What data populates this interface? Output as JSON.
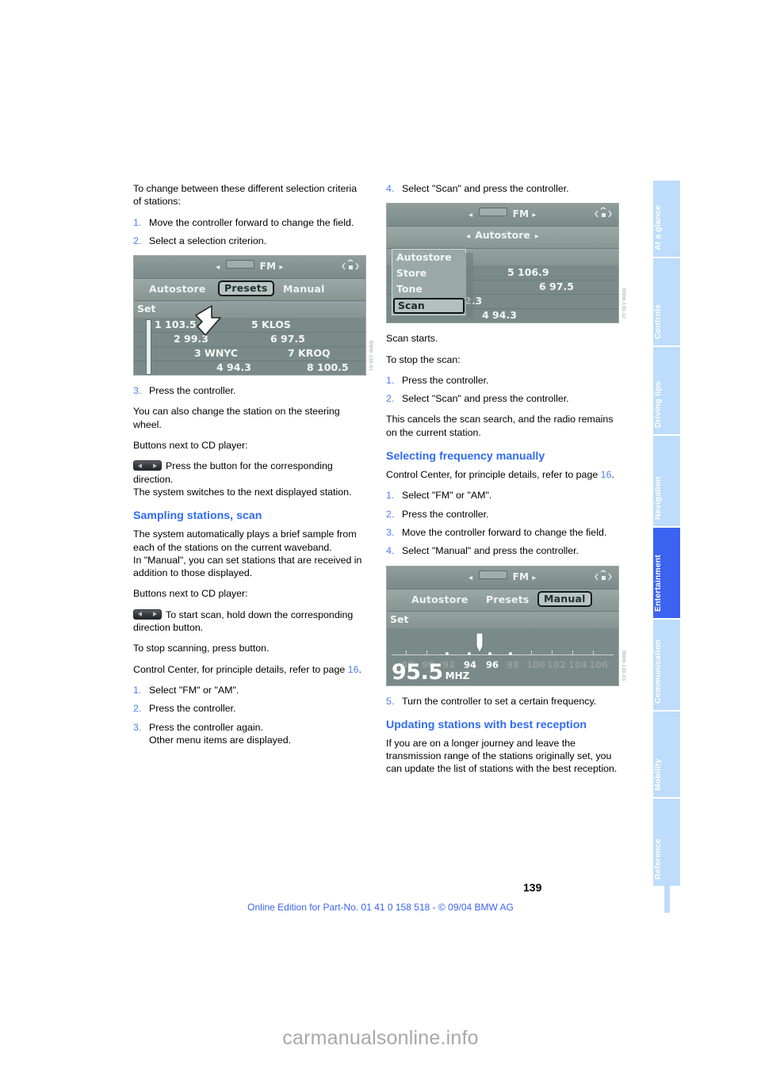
{
  "document": {
    "page_number": "139",
    "edition_line": "Online Edition for Part-No. 01 41 0 158 518 - © 09/04 BMW AG",
    "watermark": "carmanualsonline.info"
  },
  "sidebar": {
    "tabs": [
      {
        "label": "At a glance",
        "active": false
      },
      {
        "label": "Controls",
        "active": false
      },
      {
        "label": "Driving tips",
        "active": false
      },
      {
        "label": "Navigation",
        "active": false
      },
      {
        "label": "Entertainment",
        "active": true
      },
      {
        "label": "Communication",
        "active": false
      },
      {
        "label": "Mobility",
        "active": false
      },
      {
        "label": "Reference",
        "active": false
      }
    ]
  },
  "left_column": {
    "intro": "To change between these different selection criteria of stations:",
    "steps_1": [
      {
        "num": "1.",
        "text": "Move the controller forward to change the field."
      },
      {
        "num": "2.",
        "text": "Select a selection criterion."
      }
    ],
    "figure_presets": {
      "band": "FM",
      "tabs": [
        {
          "label": "Autostore",
          "selected": false
        },
        {
          "label": "Presets",
          "selected": true
        },
        {
          "label": "Manual",
          "selected": false
        }
      ],
      "set_label": "Set",
      "presets": [
        {
          "left": "1 103.5",
          "right": "5 KLOS"
        },
        {
          "left": "2 99.3",
          "right": "6 97.5"
        },
        {
          "left": "3 WNYC",
          "right": "7 KROQ"
        },
        {
          "left": "4 94.3",
          "right": "8 100.5"
        }
      ]
    },
    "step_3": {
      "num": "3.",
      "text": "Press the controller."
    },
    "para_steering": "You can also change the station on the steering wheel.",
    "para_cd_buttons": "Buttons next to CD player:",
    "para_direction": "Press the button for the corresponding direction.",
    "para_switches": "The system switches to the next displayed station.",
    "heading_sampling": "Sampling stations, scan",
    "para_sample": "The system automatically plays a brief sample from each of the stations on the current waveband.",
    "para_manual_set": "In \"Manual\", you can set stations that are received in addition to those displayed.",
    "para_cd_buttons_2": "Buttons next to CD player:",
    "para_start_scan": "To start scan, hold down the corresponding direction button.",
    "para_stop_scan": "To stop scanning, press button.",
    "para_control_center_pre": "Control Center, for principle details, refer to page ",
    "para_control_center_ref": "16",
    "para_control_center_post": ".",
    "steps_2": [
      {
        "num": "1.",
        "text": "Select \"FM\" or \"AM\"."
      },
      {
        "num": "2.",
        "text": "Press the controller."
      },
      {
        "num": "3.",
        "text": "Press the controller again.\nOther menu items are displayed."
      }
    ]
  },
  "right_column": {
    "step_4": {
      "num": "4.",
      "text": "Select \"Scan\" and press the controller."
    },
    "figure_scan": {
      "band": "FM",
      "center_label": "Autostore",
      "menu": [
        {
          "label": "Autostore",
          "selected": false
        },
        {
          "label": "Store",
          "selected": false
        },
        {
          "label": "Tone",
          "selected": false
        },
        {
          "label": "Scan",
          "selected": true
        }
      ],
      "presets": [
        {
          "left": "",
          "right": "5 106.9"
        },
        {
          "left": "",
          "right": "6 97.5"
        },
        {
          "left": "2.3",
          "right": ""
        },
        {
          "left": "4 94.3",
          "right": ""
        }
      ]
    },
    "para_scan_starts": "Scan starts.",
    "para_stop_scan": "To stop the scan:",
    "steps_stop": [
      {
        "num": "1.",
        "text": "Press the controller."
      },
      {
        "num": "2.",
        "text": "Select \"Scan\" and press the controller."
      }
    ],
    "para_cancels": "This cancels the scan search, and the radio remains on the current station.",
    "heading_freq": "Selecting frequency manually",
    "para_control_center_pre": "Control Center, for principle details, refer to page ",
    "para_control_center_ref": "16",
    "para_control_center_post": ".",
    "steps_freq": [
      {
        "num": "1.",
        "text": "Select \"FM\" or \"AM\"."
      },
      {
        "num": "2.",
        "text": "Press the controller."
      },
      {
        "num": "3.",
        "text": "Move the controller forward to change the field."
      },
      {
        "num": "4.",
        "text": "Select \"Manual\" and press the controller."
      }
    ],
    "figure_manual": {
      "band": "FM",
      "tabs": [
        {
          "label": "Autostore",
          "selected": false
        },
        {
          "label": "Presets",
          "selected": false
        },
        {
          "label": "Manual",
          "selected": true
        }
      ],
      "set_label": "Set",
      "scale_ticks": [
        "88",
        "90",
        "92",
        "94",
        "96",
        "98",
        "100",
        "102",
        "104",
        "106"
      ],
      "scale_highlighted": [
        "94",
        "96"
      ],
      "frequency_value": "95.5",
      "frequency_unit": "MHZ"
    },
    "step_5": {
      "num": "5.",
      "text": "Turn the controller to set a certain frequency."
    },
    "heading_updating": "Updating stations with best reception",
    "para_updating": "If you are on a longer journey and leave the transmission range of the stations originally set, you can update the list of stations with the best reception."
  },
  "colors": {
    "accent_blue": "#3b63f0",
    "list_number_blue": "#4f7ff0",
    "tab_blue": "#bedcfb",
    "display_bg": "#7e8e8c"
  }
}
